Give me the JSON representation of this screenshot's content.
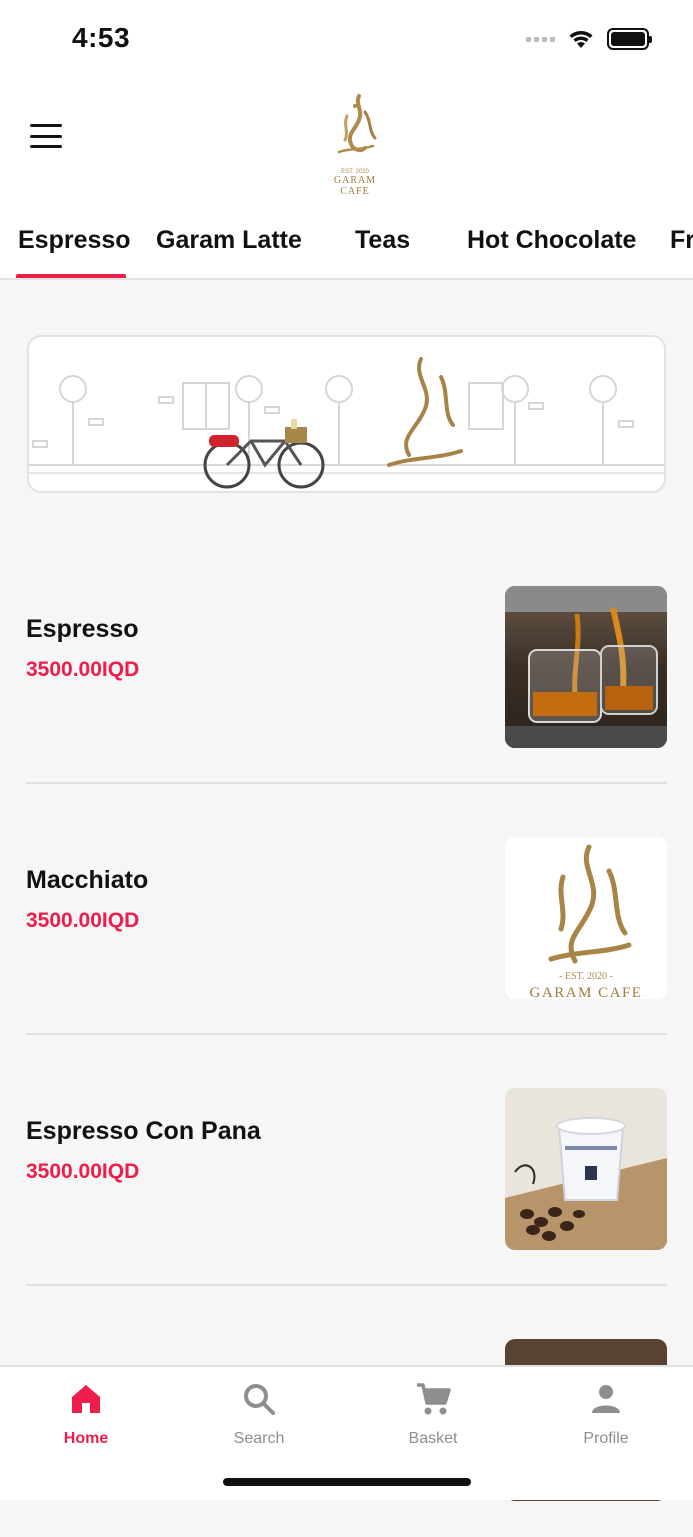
{
  "status_bar": {
    "time": "4:53"
  },
  "header": {
    "logo_est": "EST. 2020",
    "logo_name": "GARAM CAFE"
  },
  "tabs": [
    {
      "label": "Espresso",
      "active": true
    },
    {
      "label": "Garam Latte",
      "active": false
    },
    {
      "label": "Teas",
      "active": false
    },
    {
      "label": "Hot Chocolate",
      "active": false
    },
    {
      "label": "Fr",
      "active": false
    }
  ],
  "products": [
    {
      "name": "Espresso",
      "price": "3500.00IQD",
      "image": "espresso-photo"
    },
    {
      "name": "Macchiato",
      "price": "3500.00IQD",
      "image": "garam-cafe-logo"
    },
    {
      "name": "Espresso Con Pana",
      "price": "3500.00IQD",
      "image": "cup-and-beans-photo"
    }
  ],
  "bottom_nav": [
    {
      "label": "Home",
      "icon": "home-icon",
      "active": true
    },
    {
      "label": "Search",
      "icon": "search-icon",
      "active": false
    },
    {
      "label": "Basket",
      "icon": "cart-icon",
      "active": false
    },
    {
      "label": "Profile",
      "icon": "profile-icon",
      "active": false
    }
  ],
  "colors": {
    "accent": "#ee1d4c",
    "gold": "#b08a4a",
    "background": "#f6f6f6"
  }
}
